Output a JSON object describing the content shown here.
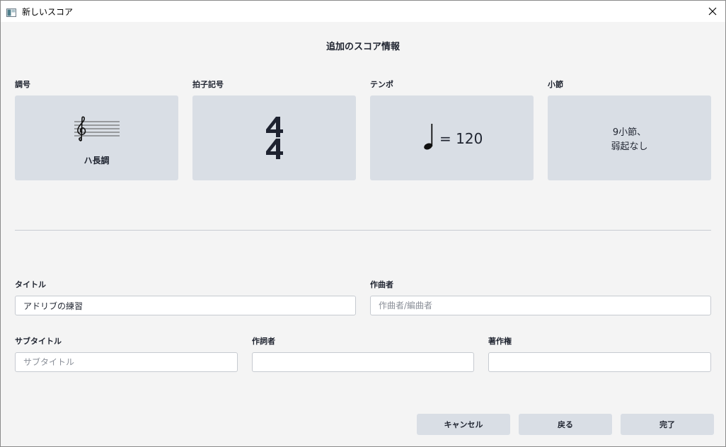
{
  "window": {
    "title": "新しいスコア",
    "icons": {
      "app": "app-window-icon",
      "close": "close-icon"
    }
  },
  "heading": "追加のスコア情報",
  "cards": {
    "key": {
      "label": "調号",
      "caption": "ハ長調",
      "icon": "treble-clef-staff-icon"
    },
    "time": {
      "label": "拍子記号",
      "icon": "time-signature-4-4-icon"
    },
    "tempo": {
      "label": "テンポ",
      "value": "= 120",
      "icon": "quarter-note-icon"
    },
    "measures": {
      "label": "小節",
      "line1": "9小節、",
      "line2": "弱起なし"
    }
  },
  "fields": {
    "title": {
      "label": "タイトル",
      "value": "アドリブの練習",
      "placeholder": ""
    },
    "composer": {
      "label": "作曲者",
      "value": "",
      "placeholder": "作曲者/編曲者"
    },
    "subtitle": {
      "label": "サブタイトル",
      "value": "",
      "placeholder": "サブタイトル"
    },
    "lyricist": {
      "label": "作詞者",
      "value": "",
      "placeholder": ""
    },
    "copyright": {
      "label": "著作権",
      "value": "",
      "placeholder": ""
    }
  },
  "buttons": {
    "cancel": "キャンセル",
    "back": "戻る",
    "finish": "完了"
  },
  "colors": {
    "card_bg": "#d9dee5",
    "window_bg": "#f4f4f4",
    "text": "#1f2430"
  }
}
